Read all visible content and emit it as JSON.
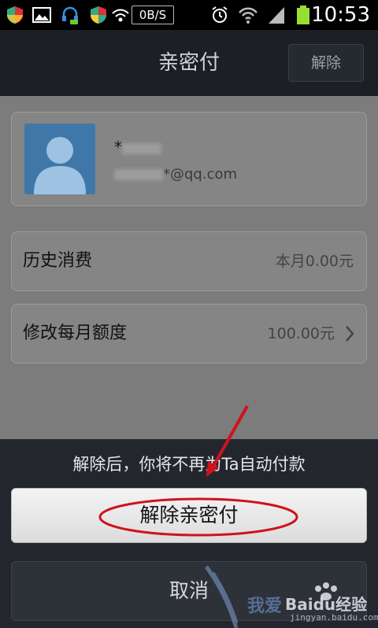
{
  "status_bar": {
    "net_speed": "0B/S",
    "time": "10:53",
    "icons": [
      "shield-icon",
      "image-icon",
      "headset-icon",
      "shield-icon",
      "wifi-icon",
      "alarm-icon",
      "wifi-signal-icon",
      "cell-signal-icon",
      "battery-icon"
    ]
  },
  "header": {
    "title": "亲密付",
    "remove_label": "解除"
  },
  "profile": {
    "name": "*",
    "email_suffix": "*@qq.com"
  },
  "rows": {
    "history_label": "历史消费",
    "history_value": "本月0.00元",
    "quota_label": "修改每月额度",
    "quota_value": "100.00元"
  },
  "sheet": {
    "message": "解除后，你将不再为Ta自动付款",
    "confirm_label": "解除亲密付",
    "cancel_label": "取消"
  },
  "watermark": {
    "text": "我爱",
    "brand": "Baidu经验",
    "url": "jingyan.baidu.com"
  },
  "colors": {
    "title_bar": "#1c2026",
    "sheet_bg": "#23272d",
    "avatar": "#3f78a8",
    "annotation": "#d0121b"
  }
}
